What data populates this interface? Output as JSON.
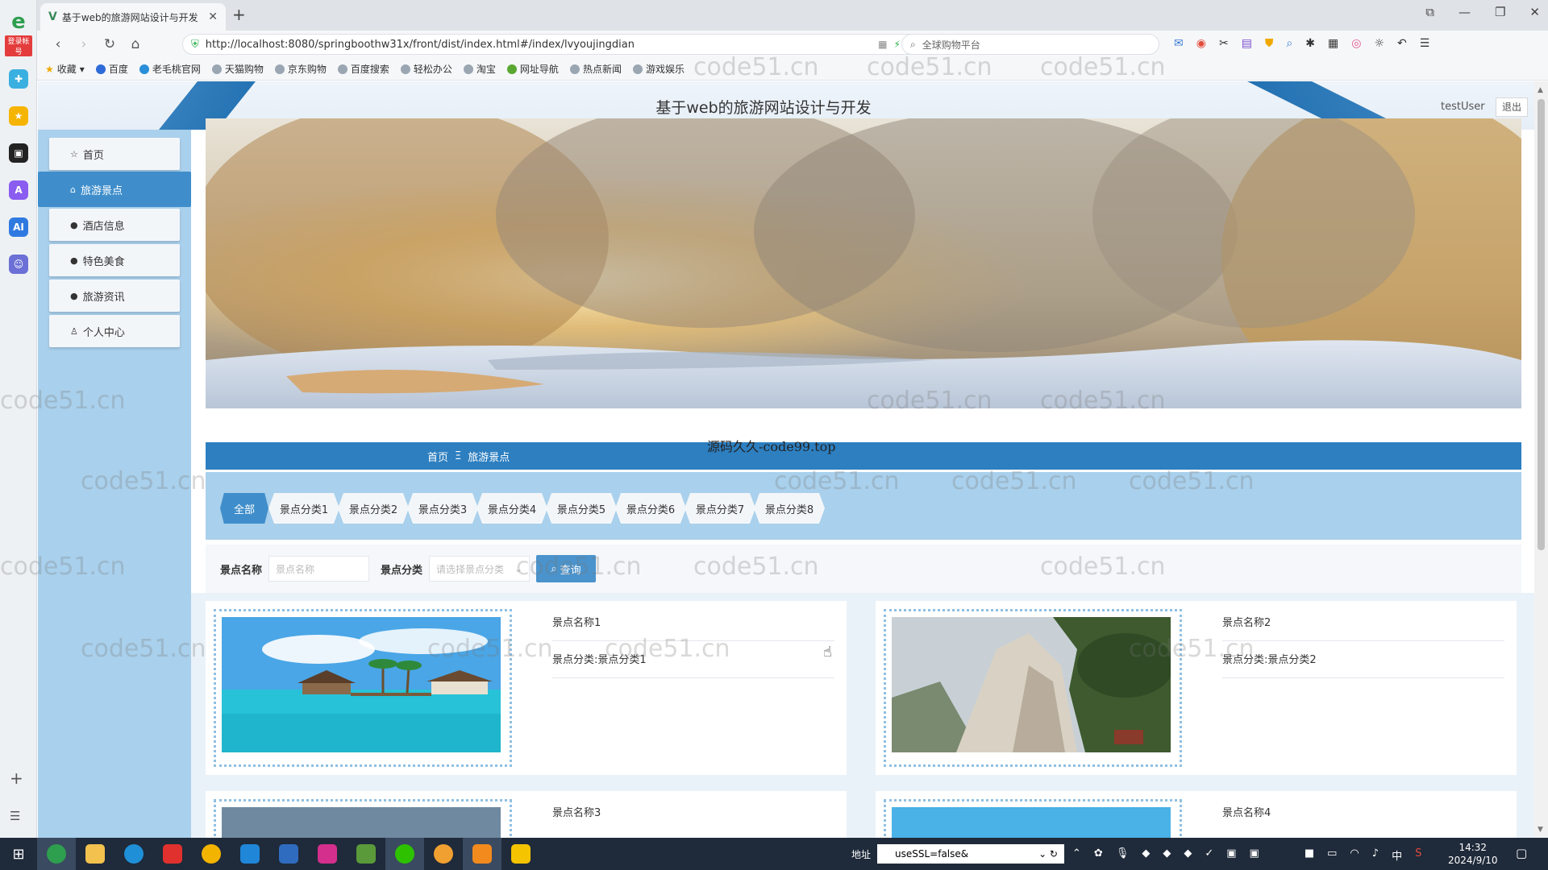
{
  "browser": {
    "tab_title": "基于web的旅游网站设计与开发",
    "url": "http://localhost:8080/springboothw31x/front/dist/index.html#/index/lvyoujingdian",
    "search_placeholder": "全球购物平台",
    "login_badge": "登录帐号",
    "bookmarks": [
      "收藏",
      "百度",
      "老毛桃官网",
      "天猫购物",
      "京东购物",
      "百度搜索",
      "轻松办公",
      "淘宝",
      "网址导航",
      "热点新闻",
      "游戏娱乐"
    ]
  },
  "site": {
    "title": "基于web的旅游网站设计与开发",
    "user": "testUser",
    "logout": "退出",
    "watermark": "源码久久-code99.top",
    "code_watermark": "code51.cn"
  },
  "sidebar": {
    "items": [
      {
        "label": "首页",
        "icon": "star-icon"
      },
      {
        "label": "旅游景点",
        "icon": "home-icon"
      },
      {
        "label": "酒店信息",
        "icon": "info-icon"
      },
      {
        "label": "特色美食",
        "icon": "question-icon"
      },
      {
        "label": "旅游资讯",
        "icon": "info-icon"
      },
      {
        "label": "个人中心",
        "icon": "user-icon"
      }
    ],
    "active_index": 1
  },
  "breadcrumb": {
    "home": "首页",
    "separator": "Ξ",
    "current": "旅游景点"
  },
  "categories": [
    "全部",
    "景点分类1",
    "景点分类2",
    "景点分类3",
    "景点分类4",
    "景点分类5",
    "景点分类6",
    "景点分类7",
    "景点分类8"
  ],
  "search": {
    "name_label": "景点名称",
    "name_placeholder": "景点名称",
    "category_label": "景点分类",
    "category_placeholder": "请选择景点分类",
    "button": "查询"
  },
  "cards": [
    {
      "name": "景点名称1",
      "category": "景点分类:景点分类1"
    },
    {
      "name": "景点名称2",
      "category": "景点分类:景点分类2"
    },
    {
      "name": "景点名称3",
      "category": ""
    },
    {
      "name": "景点名称4",
      "category": ""
    }
  ],
  "taskbar": {
    "addr_label": "地址",
    "addr_value": "useSSL=false&",
    "time": "14:32",
    "date": "2024/9/10",
    "ime": "中"
  },
  "colors": {
    "primary": "#2d7fc0",
    "sidebar": "#a9d0ec",
    "active": "#3f8ecb"
  }
}
